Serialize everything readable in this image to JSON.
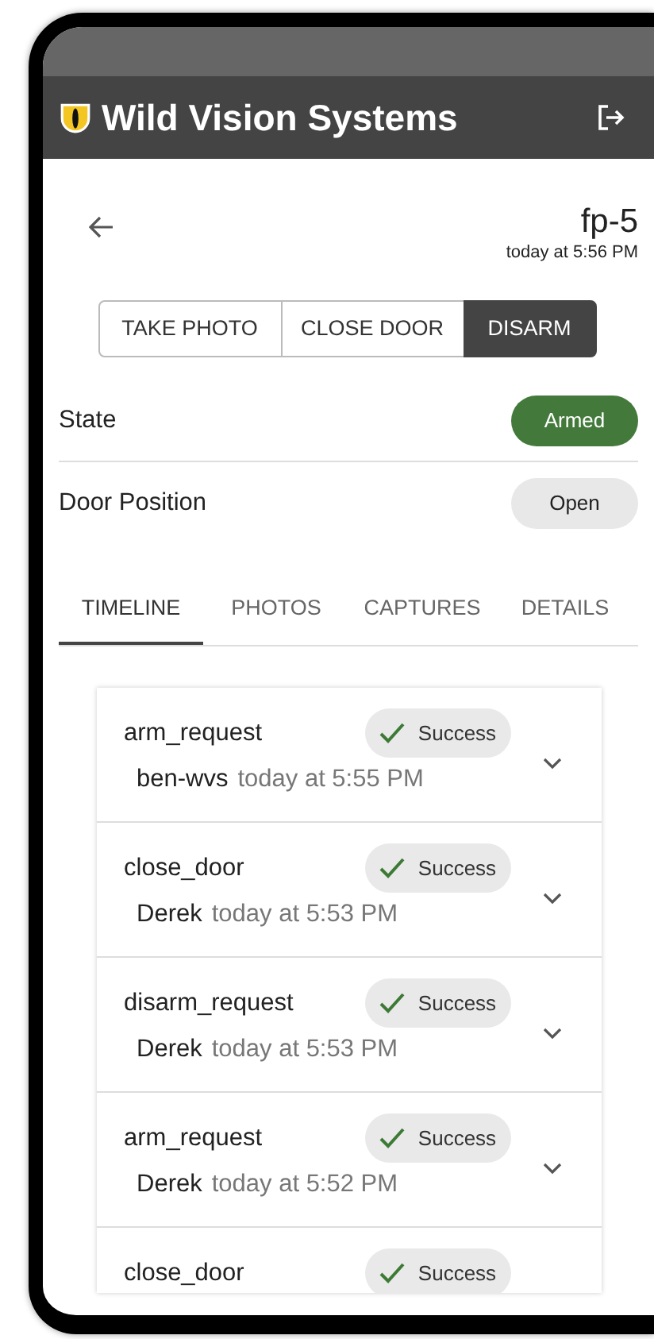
{
  "app": {
    "title": "Wild Vision Systems"
  },
  "device": {
    "name": "fp-5",
    "updated": "today at 5:56 PM"
  },
  "actions": [
    {
      "label": "TAKE PHOTO",
      "selected": false
    },
    {
      "label": "CLOSE DOOR",
      "selected": false
    },
    {
      "label": "DISARM",
      "selected": true
    }
  ],
  "properties": [
    {
      "label": "State",
      "value": "Armed",
      "kind": "success"
    },
    {
      "label": "Door Position",
      "value": "Open",
      "kind": "neutral"
    }
  ],
  "tabs": [
    {
      "label": "TIMELINE",
      "selected": true
    },
    {
      "label": "PHOTOS",
      "selected": false
    },
    {
      "label": "CAPTURES",
      "selected": false
    },
    {
      "label": "DETAILS",
      "selected": false
    }
  ],
  "timeline": [
    {
      "event": "arm_request",
      "status": "Success",
      "user": "ben-wvs",
      "time": "today at 5:55 PM"
    },
    {
      "event": "close_door",
      "status": "Success",
      "user": "Derek",
      "time": "today at 5:53 PM"
    },
    {
      "event": "disarm_request",
      "status": "Success",
      "user": "Derek",
      "time": "today at 5:53 PM"
    },
    {
      "event": "arm_request",
      "status": "Success",
      "user": "Derek",
      "time": "today at 5:52 PM"
    },
    {
      "event": "close_door",
      "status": "Success"
    }
  ]
}
